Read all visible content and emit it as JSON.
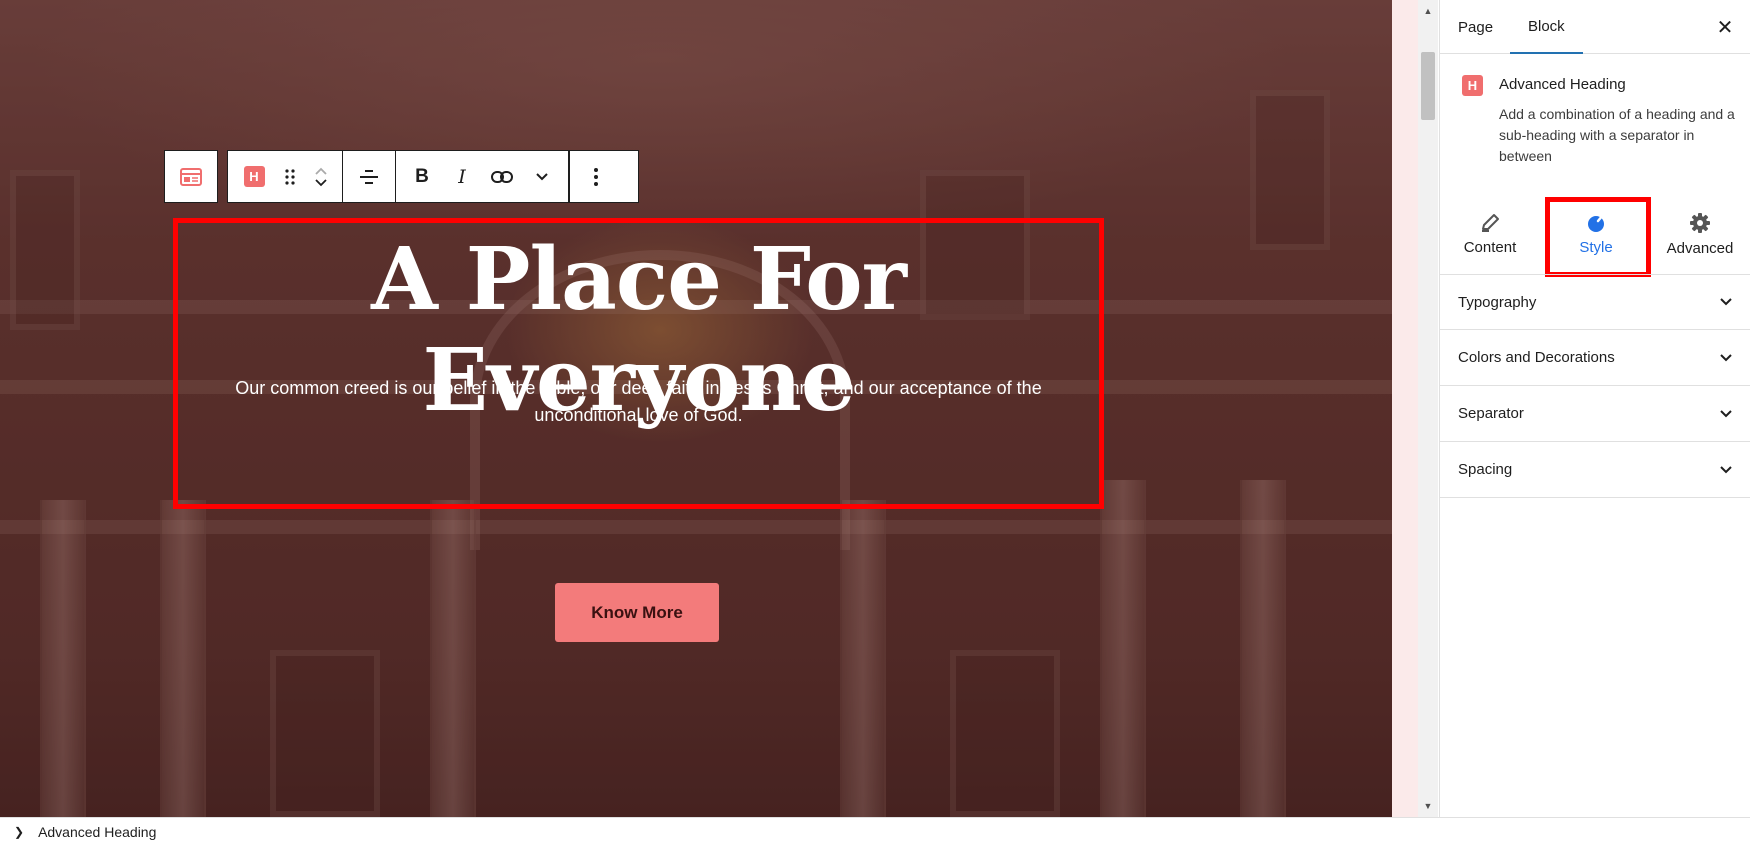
{
  "heading": {
    "title": "A Place For Everyone",
    "subtitle": "Our common creed is our belief in the Bible, our deep faith in Jesus Christ, and our acceptance of the unconditional love of God."
  },
  "cta": {
    "label": "Know More"
  },
  "toolbar": {
    "block_icon": "H",
    "buttons": [
      "parent-block-icon",
      "heading-block-icon",
      "drag-handle-icon",
      "move-up-icon",
      "move-down-icon",
      "align-icon",
      "bold-icon",
      "italic-icon",
      "link-icon",
      "more-formats-chevron-icon",
      "options-kebab-icon"
    ]
  },
  "sidebar": {
    "tabs": [
      {
        "label": "Page"
      },
      {
        "label": "Block"
      }
    ],
    "block": {
      "icon": "H",
      "name": "Advanced Heading",
      "description": "Add a combination of a heading and a sub-heading with a separator in between"
    },
    "style_tabs": [
      {
        "label": "Content",
        "icon": "pencil-icon"
      },
      {
        "label": "Style",
        "icon": "paint-drop-icon"
      },
      {
        "label": "Advanced",
        "icon": "gear-icon"
      }
    ],
    "panels": [
      {
        "label": "Typography"
      },
      {
        "label": "Colors and Decorations"
      },
      {
        "label": "Separator"
      },
      {
        "label": "Spacing"
      }
    ]
  },
  "footer": {
    "breadcrumb": "Advanced Heading"
  },
  "colors": {
    "accent": "#2271e6",
    "highlight": "#ff0000",
    "button": "#f37b7b",
    "brand": "#f06e6e"
  }
}
